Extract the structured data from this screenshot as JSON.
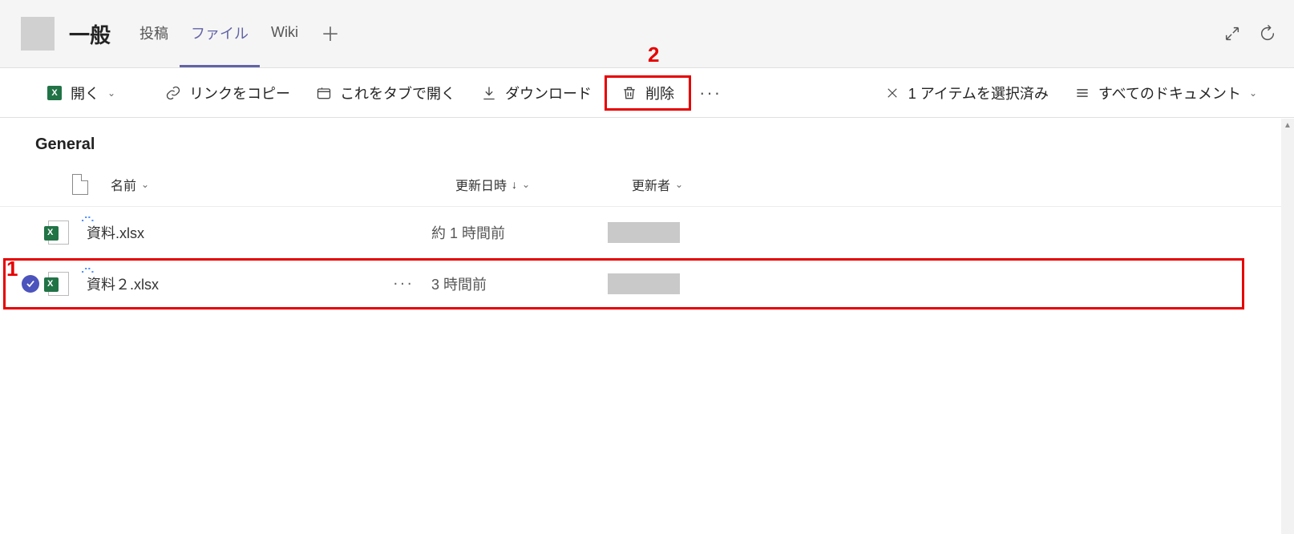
{
  "header": {
    "channel_name": "一般",
    "tabs": [
      {
        "label": "投稿",
        "active": false
      },
      {
        "label": "ファイル",
        "active": true
      },
      {
        "label": "Wiki",
        "active": false
      }
    ]
  },
  "commands": {
    "open": "開く",
    "copy_link": "リンクをコピー",
    "open_in_tab": "これをタブで開く",
    "download": "ダウンロード",
    "delete": "削除",
    "clear_selection": "1 アイテムを選択済み",
    "view_all": "すべてのドキュメント"
  },
  "annotations": {
    "one": "1",
    "two": "2"
  },
  "folder": {
    "title": "General"
  },
  "columns": {
    "name": "名前",
    "modified": "更新日時",
    "modified_by": "更新者"
  },
  "rows": [
    {
      "selected": false,
      "name": "資料.xlsx",
      "modified": "約 1 時間前",
      "modified_by_redacted": true,
      "new": true,
      "show_more": false
    },
    {
      "selected": true,
      "name": "資料２.xlsx",
      "modified": "3 時間前",
      "modified_by_redacted": true,
      "new": true,
      "show_more": true
    }
  ]
}
